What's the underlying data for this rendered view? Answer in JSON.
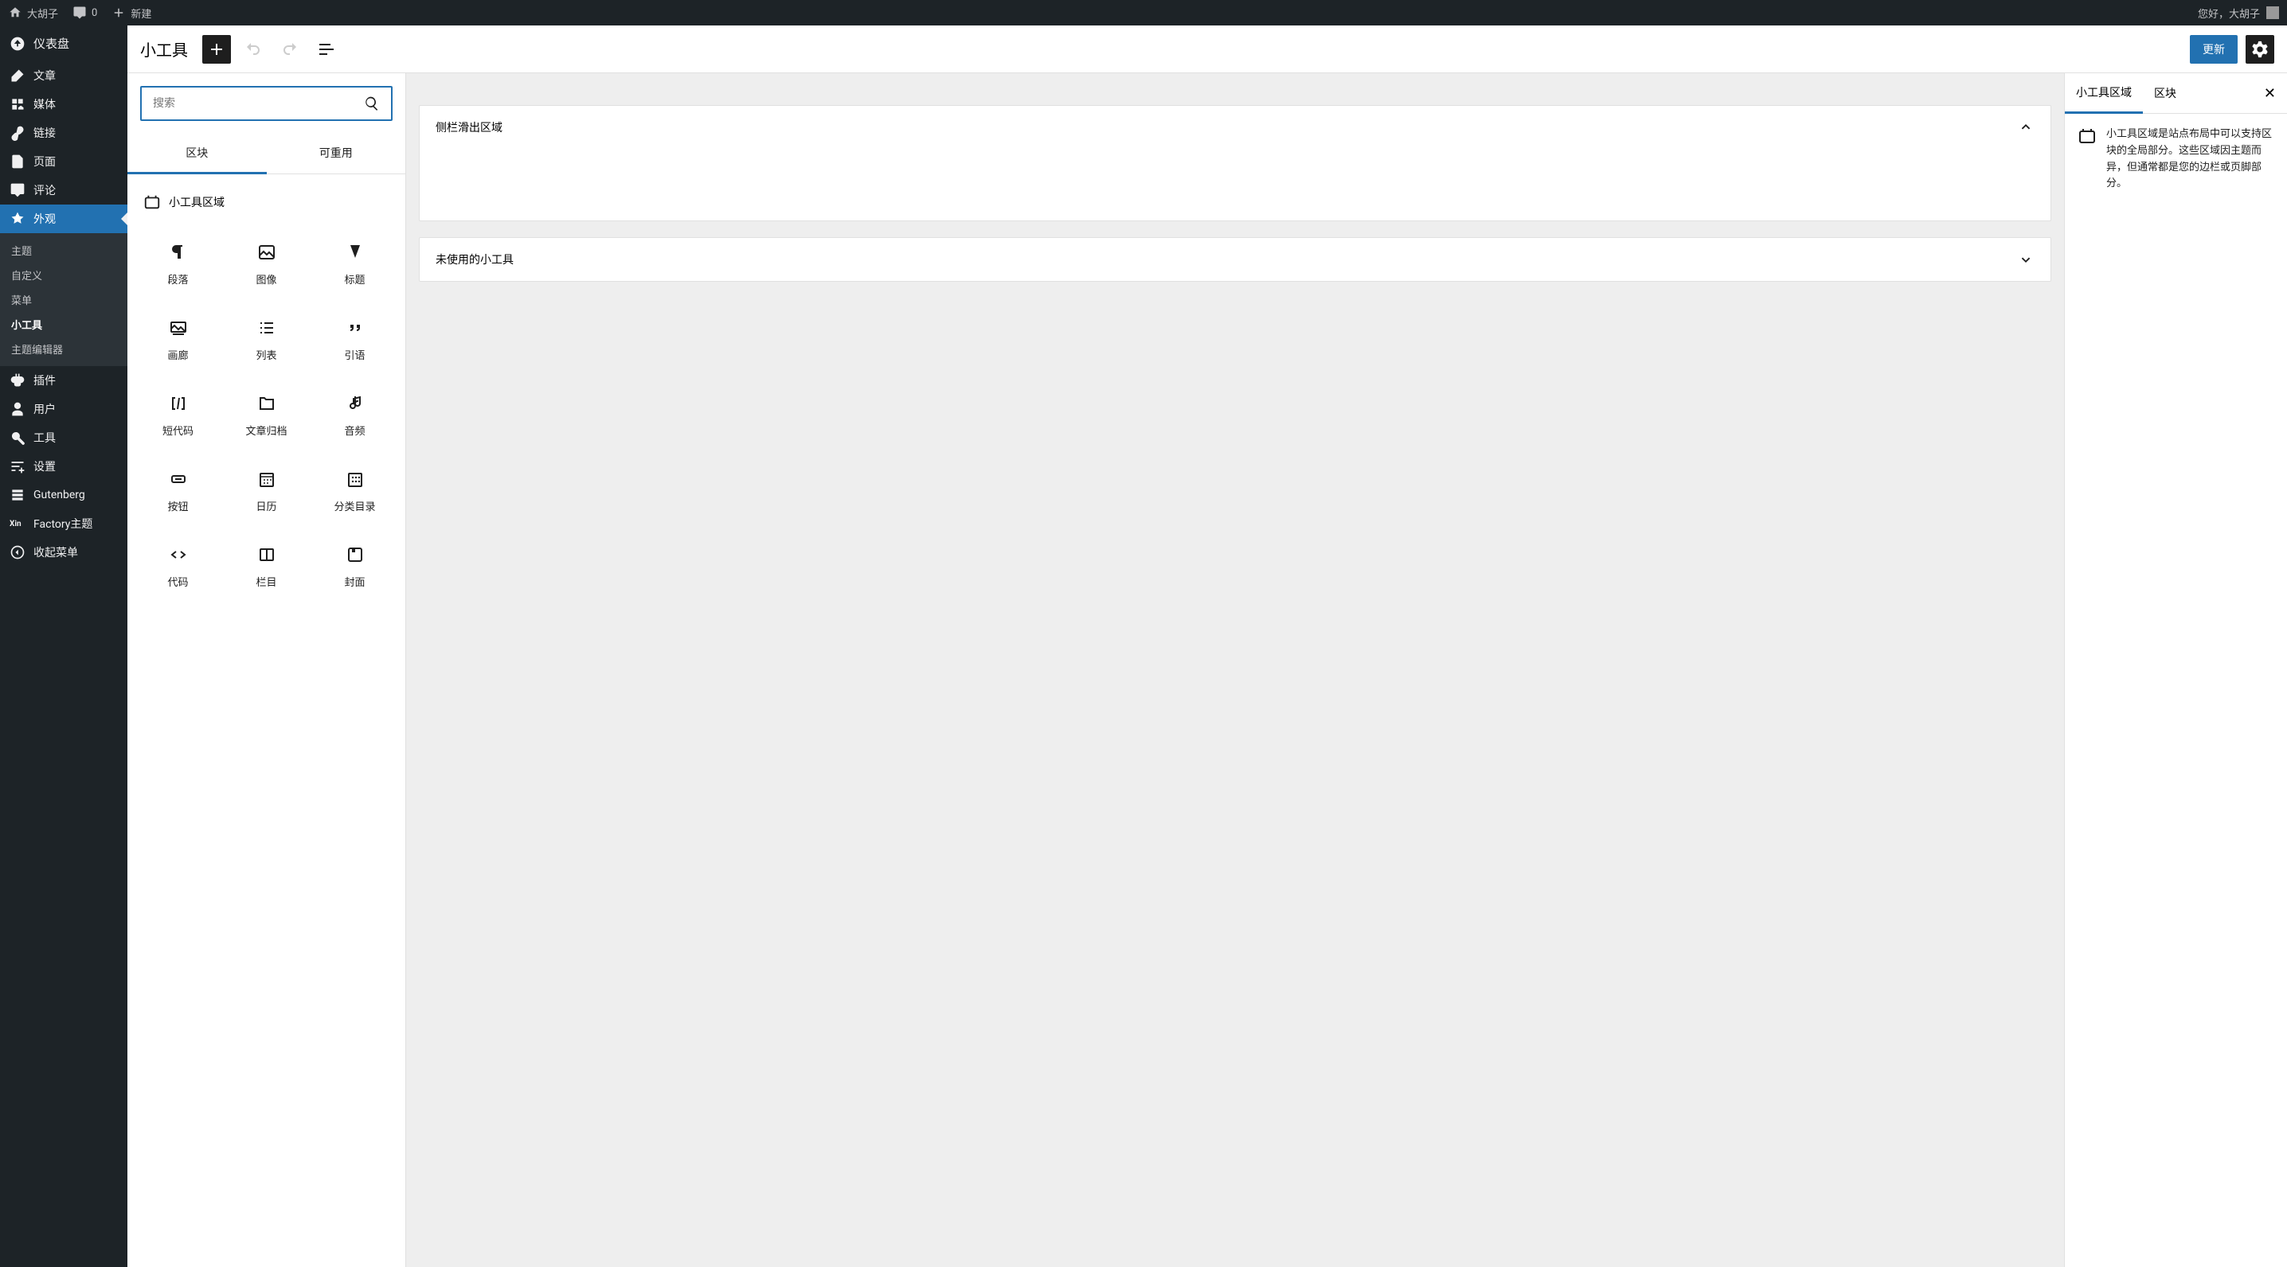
{
  "adminbar": {
    "site_name": "大胡子",
    "comments": "0",
    "new": "新建",
    "greeting": "您好，大胡子"
  },
  "sidebar": {
    "dashboard": "仪表盘",
    "items": {
      "posts": "文章",
      "media": "媒体",
      "links": "链接",
      "pages": "页面",
      "comments": "评论",
      "appearance": "外观",
      "plugins": "插件",
      "users": "用户",
      "tools": "工具",
      "settings": "设置",
      "gutenberg": "Gutenberg",
      "factory": "Factory主题",
      "collapse": "收起菜单"
    },
    "appearance_sub": {
      "themes": "主题",
      "customize": "自定义",
      "menus": "菜单",
      "widgets": "小工具",
      "theme_editor": "主题编辑器"
    }
  },
  "editor": {
    "title": "小工具",
    "update_btn": "更新",
    "search_placeholder": "搜索",
    "tabs": {
      "blocks": "区块",
      "reusable": "可重用"
    },
    "category_label": "小工具区域",
    "blocks": {
      "paragraph": "段落",
      "image": "图像",
      "heading": "标题",
      "gallery": "画廊",
      "list": "列表",
      "quote": "引语",
      "shortcode": "短代码",
      "archives": "文章归档",
      "audio": "音频",
      "button": "按钮",
      "calendar": "日历",
      "categories": "分类目录",
      "code": "代码",
      "columns": "栏目",
      "cover": "封面"
    }
  },
  "canvas": {
    "area1": "侧栏滑出区域",
    "area2": "未使用的小工具"
  },
  "settings": {
    "tab_area": "小工具区域",
    "tab_block": "区块",
    "desc": "小工具区域是站点布局中可以支持区块的全局部分。这些区域因主题而异，但通常都是您的边栏或页脚部分。"
  }
}
